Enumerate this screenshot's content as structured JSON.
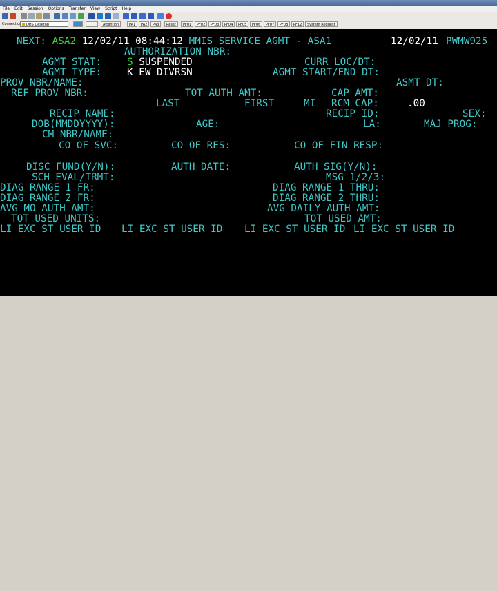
{
  "menu": [
    "File",
    "Edit",
    "Session",
    "Options",
    "Transfer",
    "View",
    "Script",
    "Help"
  ],
  "toolbar": {
    "connections_label": "Connections",
    "session_name": "DHS Desktop",
    "attention": "Attention",
    "pa_keys": [
      "PA1",
      "PA2",
      "PA3"
    ],
    "reset": "Reset",
    "pf_keys": [
      "PF01",
      "PF02",
      "PF03",
      "PF04",
      "PF05",
      "PF06",
      "PF07",
      "PF08",
      "PF12"
    ],
    "system_request": "System Request"
  },
  "screen": {
    "next_label": "NEXT:",
    "next_value": "ASA2",
    "header_dt": "12/02/11 08:44:12",
    "header_title": "MMIS SERVICE AGMT - ASA1",
    "header_date_right": "12/02/11",
    "terminal_id": "PWMW925",
    "authorization_nbr": "AUTHORIZATION NBR:",
    "agmt_stat_label": "AGMT STAT:",
    "agmt_stat_code": "S",
    "agmt_stat_value": "SUSPENDED",
    "curr_loc": "CURR LOC/DT:",
    "agmt_type_label": "AGMT TYPE:",
    "agmt_type_value": "K EW DIVRSN",
    "agmt_start_end": "AGMT START/END DT:",
    "prov_nbr_name": "PROV NBR/NAME:",
    "asmt_dt": "ASMT DT:",
    "ref_prov_nbr": "REF PROV NBR:",
    "tot_auth_amt": "TOT AUTH AMT:",
    "cap_amt": "CAP AMT:",
    "last": "LAST",
    "first": "FIRST",
    "mi": "MI",
    "rcm_cap": "RCM CAP:",
    "rcm_cap_value": ".00",
    "recip_name": "RECIP NAME:",
    "recip_id": "RECIP ID:",
    "sex": "SEX:",
    "dob": "DOB(MMDDYYYY):",
    "age": "AGE:",
    "la": "LA:",
    "maj_prog": "MAJ PROG:",
    "cm_nbr_name": "CM NBR/NAME:",
    "co_of_svc": "CO OF SVC:",
    "co_of_res": "CO OF RES:",
    "co_of_fin_resp": "CO OF FIN RESP:",
    "disc_fund": "DISC FUND(Y/N):",
    "auth_date": "AUTH DATE:",
    "auth_sig": "AUTH SIG(Y/N):",
    "sch_eval": "SCH EVAL/TRMT:",
    "msg": "MSG 1/2/3:",
    "diag_range1_fr": "DIAG RANGE 1 FR:",
    "diag_range1_thru": "DIAG RANGE 1 THRU:",
    "diag_range2_fr": "DIAG RANGE 2 FR:",
    "diag_range2_thru": "DIAG RANGE 2 THRU:",
    "avg_mo_auth_amt": "AVG MO AUTH AMT:",
    "avg_daily_auth_amt": "AVG DAILY AUTH AMT:",
    "tot_used_units": "TOT USED UNITS:",
    "tot_used_amt": "TOT USED AMT:",
    "li_exc_header": "LI EXC ST USER ID"
  }
}
